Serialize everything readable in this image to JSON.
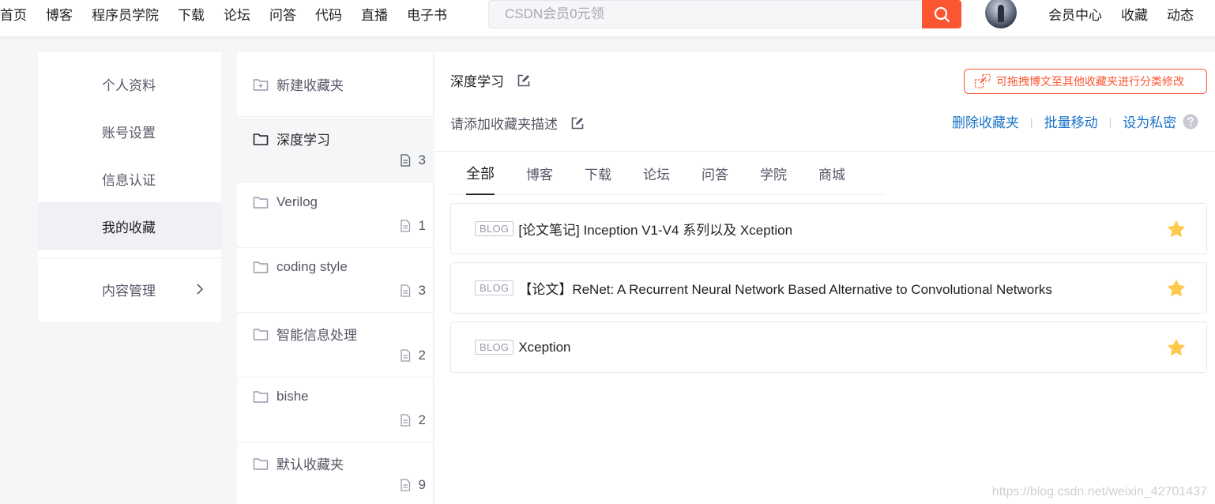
{
  "topnav": {
    "links": [
      "首页",
      "博客",
      "程序员学院",
      "下载",
      "论坛",
      "问答",
      "代码",
      "直播",
      "电子书"
    ],
    "search_placeholder": "CSDN会员0元领",
    "right_links": [
      "会员中心",
      "收藏",
      "动态"
    ]
  },
  "side_menu": {
    "items": [
      "个人资料",
      "账号设置",
      "信息认证",
      "我的收藏"
    ],
    "content_manage": "内容管理"
  },
  "folders": {
    "new_folder": "新建收藏夹",
    "items": [
      {
        "name": "深度学习",
        "count": "3"
      },
      {
        "name": "Verilog",
        "count": "1"
      },
      {
        "name": "coding style",
        "count": "3"
      },
      {
        "name": "智能信息处理",
        "count": "2"
      },
      {
        "name": "bishe",
        "count": "2"
      },
      {
        "name": "默认收藏夹",
        "count": "9"
      }
    ]
  },
  "main": {
    "folder_title": "深度学习",
    "folder_desc": "请添加收藏夹描述",
    "drag_tip": "可拖拽博文至其他收藏夹进行分类修改",
    "actions": {
      "delete": "删除收藏夹",
      "batch_move": "批量移动",
      "set_private": "设为私密"
    },
    "tabs": [
      "全部",
      "博客",
      "下载",
      "论坛",
      "问答",
      "学院",
      "商城"
    ],
    "blogs": [
      {
        "tag": "BLOG",
        "title": "[论文笔记] Inception V1-V4 系列以及 Xception"
      },
      {
        "tag": "BLOG",
        "title": "【论文】ReNet: A Recurrent Neural Network Based Alternative to Convolutional Networks"
      },
      {
        "tag": "BLOG",
        "title": "Xception"
      }
    ]
  },
  "watermark": "https://blog.csdn.net/weixin_42701437",
  "colors": {
    "accent": "#fc5531",
    "link": "#1a73c8",
    "star": "#ffc94d"
  }
}
